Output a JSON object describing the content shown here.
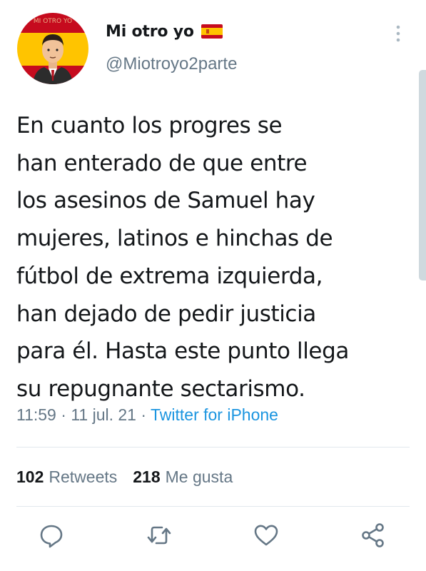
{
  "tweet": {
    "avatar_text": "MI OTRO YO",
    "display_name": "Mi otro yo",
    "flag_icon": "spain-flag-icon",
    "handle": "@Miotroyo2parte",
    "text_lines": [
      "En cuanto los progres se",
      "han enterado de que entre",
      "los asesinos de Samuel hay",
      "mujeres, latinos e hinchas de",
      "fútbol de extrema izquierda,",
      "han dejado de pedir justicia",
      "para él. Hasta este punto llega",
      "su repugnante sectarismo."
    ],
    "time": "11:59",
    "separator": "·",
    "date": "11 jul. 21",
    "source": "Twitter for iPhone"
  },
  "stats": {
    "retweets_count": "102",
    "retweets_label": "Retweets",
    "likes_count": "218",
    "likes_label": "Me gusta"
  },
  "actions": {
    "icons": [
      "reply-icon",
      "retweet-icon",
      "like-icon",
      "share-icon"
    ]
  },
  "colors": {
    "text": "#14171a",
    "secondary": "#657786",
    "link": "#1b95e0",
    "divider": "#e1e8ed",
    "icon": "#657786",
    "flag_red": "#c60b1e",
    "flag_yellow": "#ffc400"
  }
}
